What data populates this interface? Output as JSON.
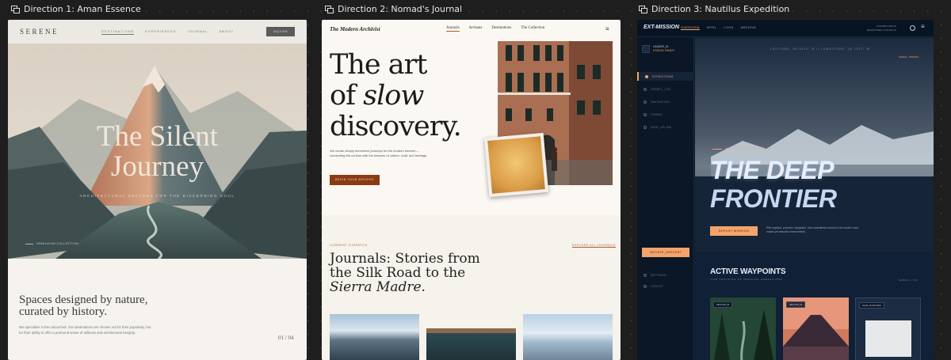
{
  "frames": [
    {
      "label": "Direction 1: Aman Essence"
    },
    {
      "label": "Direction 2: Nomad's Journal"
    },
    {
      "label": "Direction 3: Nautilus Expedition"
    }
  ],
  "aman": {
    "logo": "SERENE",
    "nav": [
      "DESTINATIONS",
      "EXPERIENCES",
      "JOURNAL",
      "ABOUT"
    ],
    "inquire": "INQUIRE",
    "hero_line1": "The Silent",
    "hero_line2": "Journey",
    "hero_subtitle": "ARCHITECTURAL ESCAPES FOR THE DISCERNING SOUL",
    "hero_caption": "HIMALAYAN COLLECTION",
    "section_title_line1": "Spaces designed by nature,",
    "section_title_line2": "curated by history.",
    "section_body": "We specialize in the untouched. Our destinations are chosen not for their popularity, but for their ability to offer a profound sense of stillness and architectural integrity.",
    "pagination": "01 / 04"
  },
  "nomad": {
    "logo": "The Modern Archivist",
    "nav": [
      "Journals",
      "Artisans",
      "Destinations",
      "The Collection"
    ],
    "headline_line1": "The art",
    "headline_of": "of ",
    "headline_slow": "slow",
    "headline_line3": "discovery.",
    "description": "We curate deeply immersive journeys for the modern traveler—connecting the curious with the keepers of culture, craft, and heritage.",
    "cta": "BEGIN YOUR ARCHIVE",
    "eyebrow": "CURRENT DISPATCH",
    "explore": "EXPLORE ALL JOURNALS",
    "section_line1": "Journals: Stories from",
    "section_line2": "the Silk Road to the",
    "section_line3": "Sierra Madre."
  },
  "nautilus": {
    "logo": "EXT-MISSION",
    "nav": [
      "OVERVIEW",
      "INTEL",
      "LOGS",
      "ARCHIVE"
    ],
    "sys_line1": "SYSTEM STATUS",
    "sys_line2": "ENCRYPTED // ACTIVE 42",
    "user_id": "LEADER_01",
    "user_status": "STATUS: READY",
    "sidebar": [
      "EXPEDITIONS",
      "VESSEL_LOG",
      "NAVIGATION",
      "COMMS",
      "DATA_UPLINK"
    ],
    "sidebar_bottom": [
      "SETTINGS",
      "LOGOUT"
    ],
    "initiate": "INITIATE_DESCENT",
    "coords": "LATITUDE: 65.9412° N // LONGITUDE: 18.7231° W",
    "coords_status": "SIGNAL: STRONG",
    "subtitle": "MISSION PROTOCOL 07",
    "title_line1": "THE DEEP",
    "title_line2": "FRONTIER",
    "deploy": "DEPLOY MISSION",
    "description": "Elite logistics, precision navigation, and unparalleled access to the world's most hostile yet beautiful environments.",
    "waypoints_title": "ACTIVE WAYPOINTS",
    "waypoints_sub": "LIVE TRACKING OF ONGOING OPERATIONS",
    "waypoints_aside": "SCROLL // 04",
    "cards": [
      "SECTOR_01",
      "SECTOR_02",
      "SLAB_PLATFORM"
    ]
  }
}
